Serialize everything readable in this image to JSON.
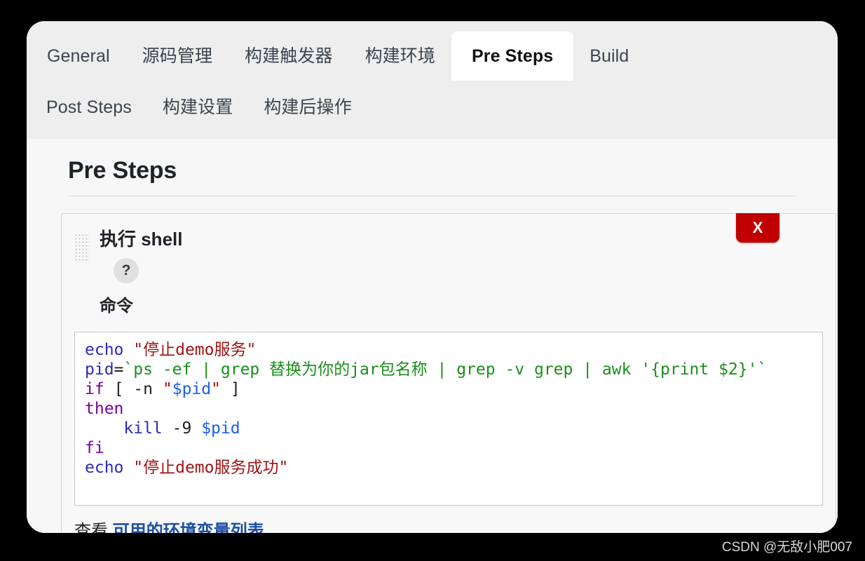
{
  "tabs": {
    "row1": [
      {
        "label": "General",
        "active": false
      },
      {
        "label": "源码管理",
        "active": false
      },
      {
        "label": "构建触发器",
        "active": false
      },
      {
        "label": "构建环境",
        "active": false
      },
      {
        "label": "Pre Steps",
        "active": true
      },
      {
        "label": "Build",
        "active": false
      }
    ],
    "row2": [
      {
        "label": "Post Steps",
        "active": false
      },
      {
        "label": "构建设置",
        "active": false
      },
      {
        "label": "构建后操作",
        "active": false
      }
    ]
  },
  "page": {
    "title": "Pre Steps"
  },
  "step": {
    "title": "执行 shell",
    "help_icon_label": "?",
    "delete_label": "X",
    "command_label": "命令",
    "code": "echo \"停止demo服务\"\npid=`ps -ef | grep 替换为你的jar包名称 | grep -v grep | awk '{print $2}'`\nif [ -n \"$pid\" ]\nthen\n    kill -9 $pid\nfi\necho \"停止demo服务成功\"",
    "footer_prefix": "查看",
    "footer_link": "可用的环境变量列表"
  },
  "colors": {
    "delete_button": "#c00000",
    "link": "#1d4fa3",
    "tab_strip_bg": "#eeeeee",
    "page_bg": "#f7f7f7",
    "code_keyword": "#7a00a0",
    "code_command": "#2b2bb5",
    "code_string": "#9e1212",
    "code_subshell": "#1a8f1a",
    "code_variable": "#1a5ff0"
  },
  "watermark": "CSDN @无敌小肥007"
}
